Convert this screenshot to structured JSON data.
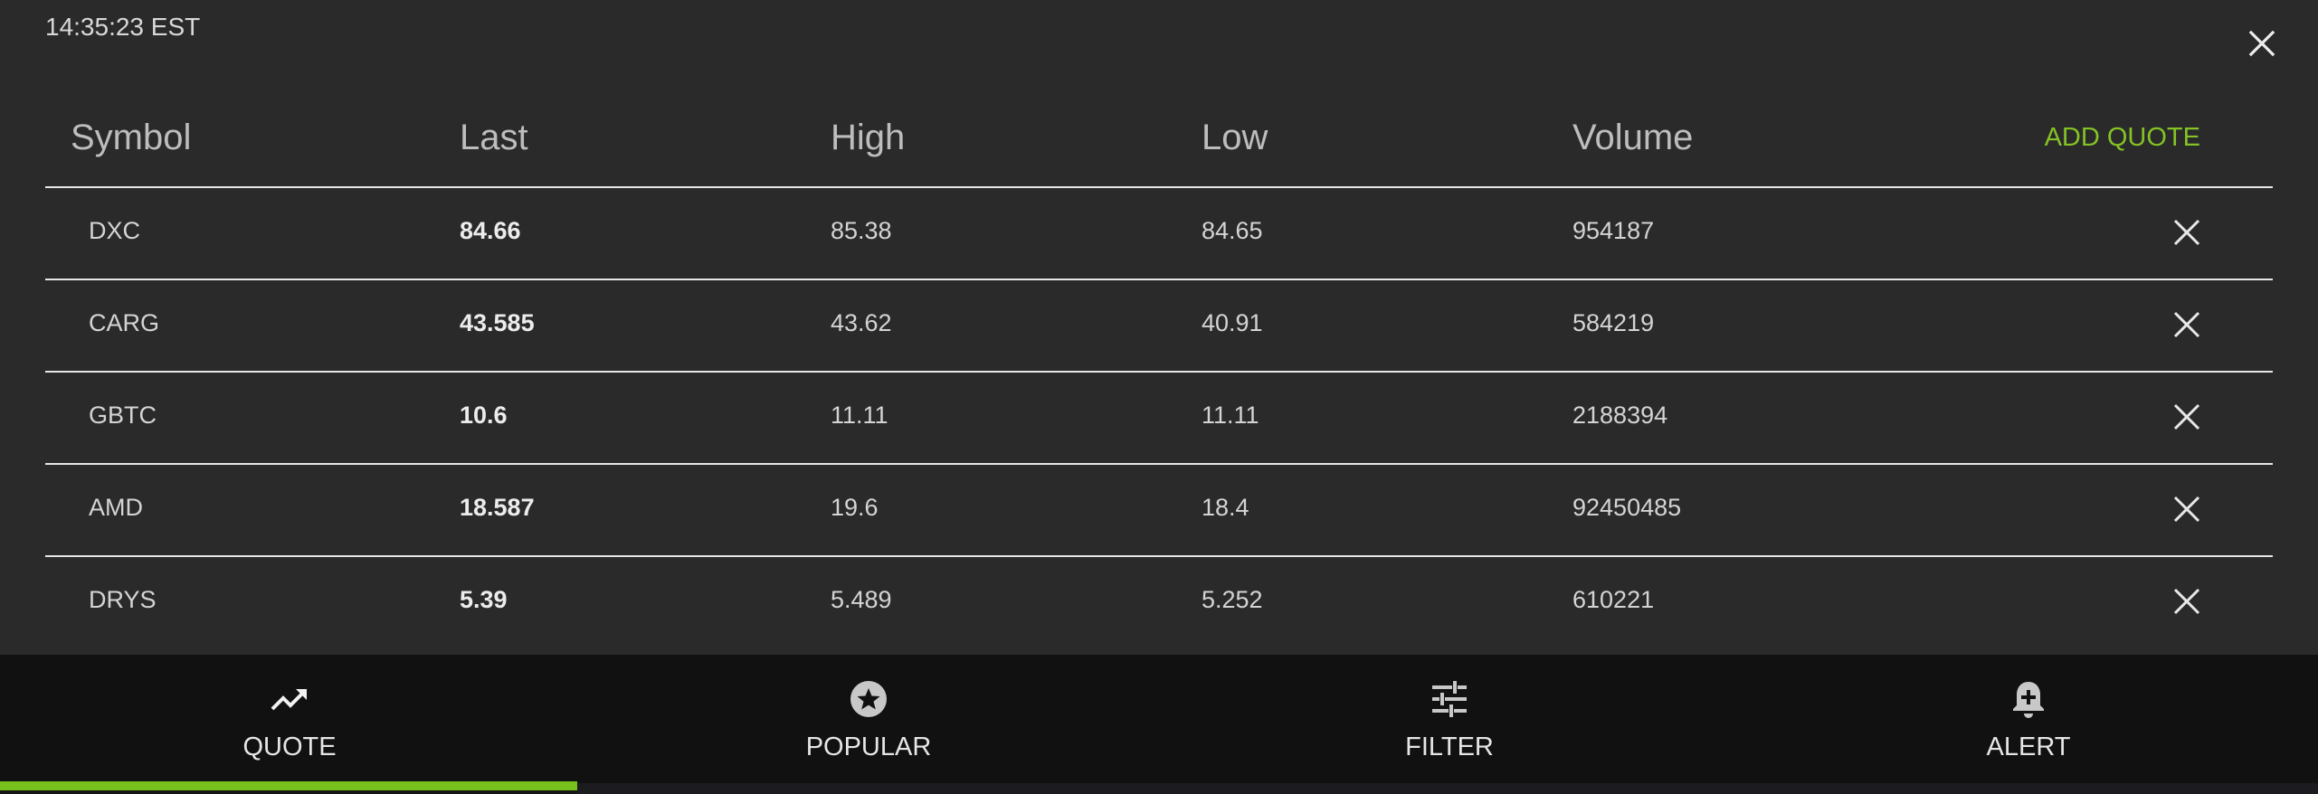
{
  "clock": {
    "time": "14:35:23 EST"
  },
  "quote_table": {
    "columns": [
      "Symbol",
      "Last",
      "High",
      "Low",
      "Volume"
    ],
    "add_label": "ADD QUOTE",
    "rows": [
      {
        "symbol": "DXC",
        "last": "84.66",
        "high": "85.38",
        "low": "84.65",
        "volume": "954187"
      },
      {
        "symbol": "CARG",
        "last": "43.585",
        "high": "43.62",
        "low": "40.91",
        "volume": "584219"
      },
      {
        "symbol": "GBTC",
        "last": "10.6",
        "high": "11.11",
        "low": "11.11",
        "volume": "2188394"
      },
      {
        "symbol": "AMD",
        "last": "18.587",
        "high": "19.6",
        "low": "18.4",
        "volume": "92450485"
      },
      {
        "symbol": "DRYS",
        "last": "5.39",
        "high": "5.489",
        "low": "5.252",
        "volume": "610221"
      }
    ]
  },
  "tabs": [
    {
      "label": "QUOTE",
      "icon": "trending-up-icon",
      "active": true
    },
    {
      "label": "POPULAR",
      "icon": "star-circle-icon",
      "active": false
    },
    {
      "label": "FILTER",
      "icon": "sliders-icon",
      "active": false
    },
    {
      "label": "ALERT",
      "icon": "bell-add-icon",
      "active": false
    }
  ],
  "colors": {
    "accent": "#84c225",
    "panel_bg": "#2a2a2a",
    "tabbar_bg": "#111111",
    "divider": "#e6e6e6"
  }
}
